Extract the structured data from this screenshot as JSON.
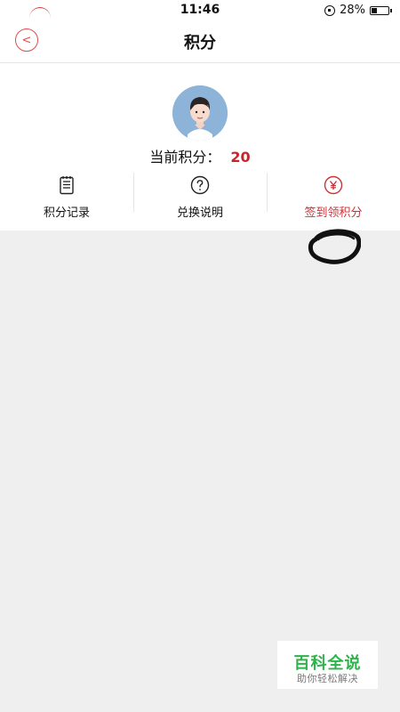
{
  "status_bar": {
    "time": "11:46",
    "battery": "28%",
    "icons": [
      "lock-icon",
      "battery-icon"
    ]
  },
  "header": {
    "title": "积分",
    "back_icon": "back-arrow-icon"
  },
  "profile": {
    "avatar_icon": "user-avatar",
    "points_label": "当前积分：",
    "points_value": "20"
  },
  "actions": [
    {
      "label": "积分记录",
      "icon": "records-icon",
      "color": "#111111"
    },
    {
      "label": "兑换说明",
      "icon": "help-circle-icon",
      "color": "#111111"
    },
    {
      "label": "签到领积分",
      "icon": "yuan-icon",
      "color": "#c9343b"
    }
  ],
  "watermark": {
    "title": "百科全说",
    "subtitle": "助你轻松解决"
  },
  "colors": {
    "accent": "#c8242d",
    "background": "#efefef",
    "watermark_green": "#2db34a"
  }
}
